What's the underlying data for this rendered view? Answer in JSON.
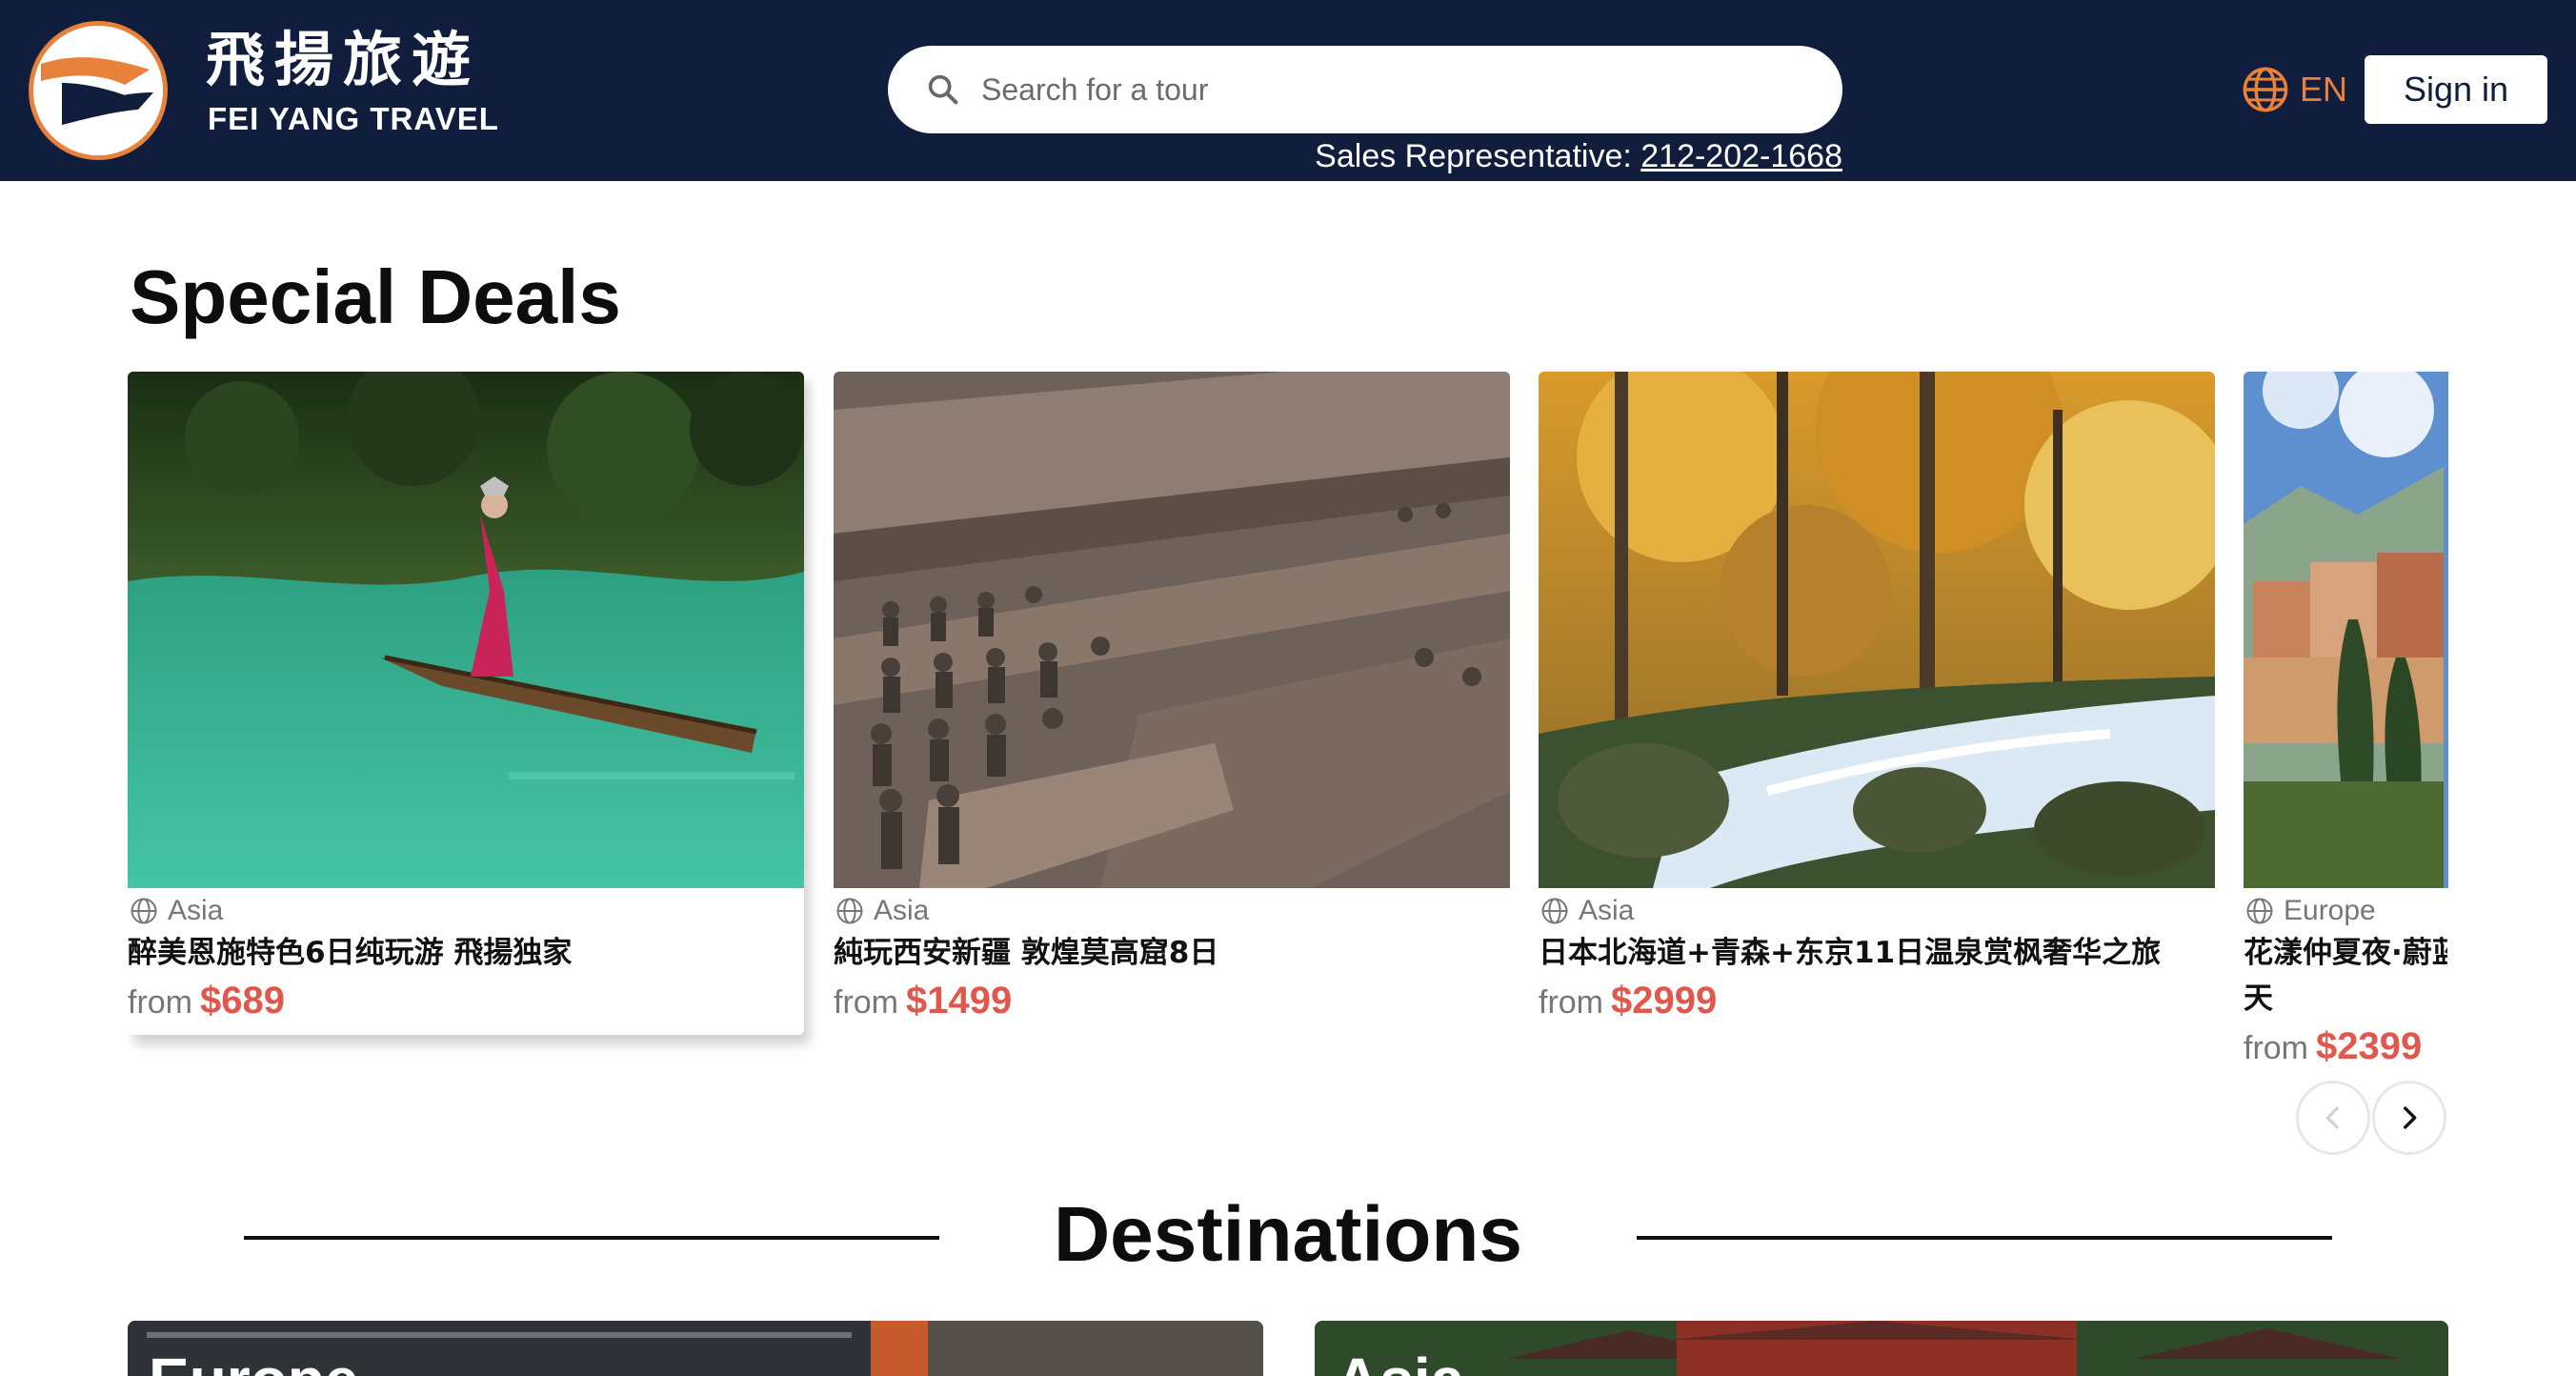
{
  "brand": {
    "name_cn": "飛揚旅遊",
    "name_en": "FEI YANG TRAVEL",
    "accent_color": "#e8813a",
    "header_color": "#111d3c"
  },
  "search": {
    "placeholder": "Search for a tour",
    "icon": "search-icon"
  },
  "sales": {
    "label": "Sales Representative: ",
    "phone": "212-202-1668"
  },
  "language": {
    "icon": "globe-icon",
    "label": "EN"
  },
  "auth": {
    "signin_label": "Sign in"
  },
  "deals": {
    "title": "Special Deals",
    "price_color": "#e2574c",
    "items": [
      {
        "region": "Asia",
        "title": "醉美恩施特色6日纯玩游 飛揚独家",
        "from": "from",
        "price": "$689"
      },
      {
        "region": "Asia",
        "title": "純玩西安新疆 敦煌莫高窟8日",
        "from": "from",
        "price": "$1499"
      },
      {
        "region": "Asia",
        "title": "日本北海道+青森+东京11日温泉赏枫奢华之旅",
        "from": "from",
        "price": "$2999"
      },
      {
        "region": "Europe",
        "title": "花漾仲夏夜·蔚蓝海岸",
        "title_line2": "天",
        "from": "from",
        "price": "$2399"
      }
    ],
    "prev_icon": "chevron-left-icon",
    "next_icon": "chevron-right-icon"
  },
  "destinations": {
    "title": "Destinations",
    "items": [
      {
        "label": "Europe"
      },
      {
        "label": "Asia"
      }
    ]
  }
}
